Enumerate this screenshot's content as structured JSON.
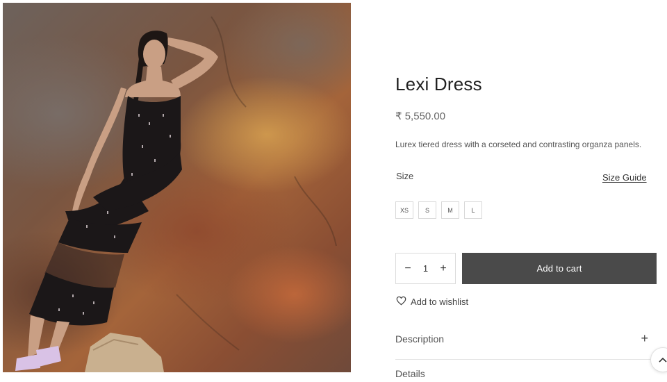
{
  "product": {
    "title": "Lexi Dress",
    "price": "₹ 5,550.00",
    "description": "Lurex tiered dress with a corseted and contrasting organza panels.",
    "image_icon": "product-photo"
  },
  "size": {
    "label": "Size",
    "guide_label": "Size Guide",
    "options": [
      "XS",
      "S",
      "M",
      "L"
    ]
  },
  "quantity": {
    "minus": "−",
    "value": "1",
    "plus": "+"
  },
  "actions": {
    "add_to_cart": "Add to cart",
    "wishlist": "Add to wishlist",
    "wishlist_icon": "heart-icon"
  },
  "accordions": [
    {
      "label": "Description",
      "icon": "plus-icon",
      "symbol": "+"
    },
    {
      "label": "Details",
      "icon": "plus-icon",
      "symbol": "+"
    }
  ],
  "scroll_top_icon": "chevron-up-icon",
  "colors": {
    "cart_button": "#4a4a4a",
    "text": "#222222"
  }
}
